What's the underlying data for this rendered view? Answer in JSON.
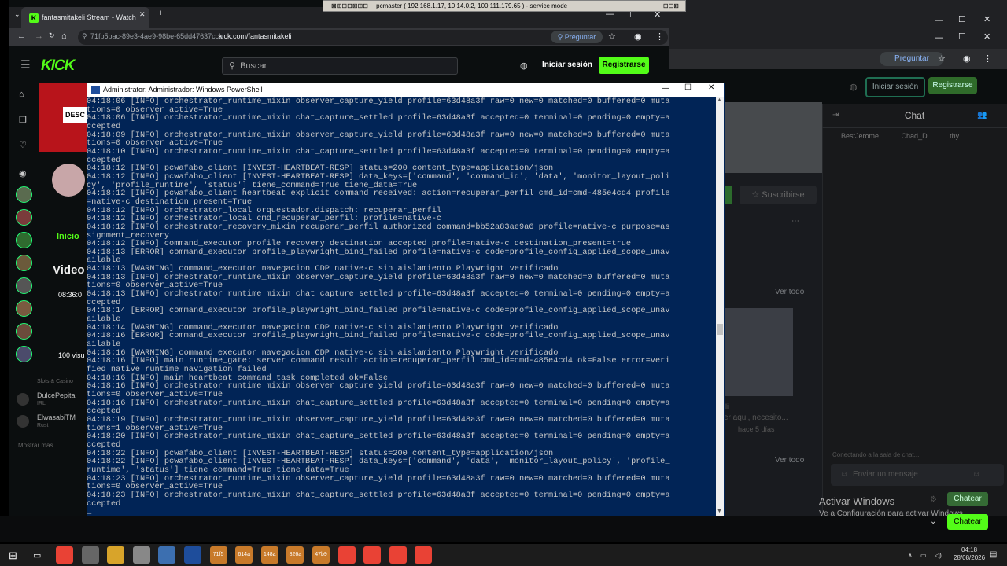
{
  "remote_bar": {
    "text": "pcmaster ( 192.168.1.17, 10.14.0.2, 100.111.179.65 ) - service mode"
  },
  "browser": {
    "tab_title": "fantasmitakeli Stream - Watch",
    "tab_close": "✕",
    "new_tab": "+",
    "omnibox_id": "71fb5bac-89e3-4ae9-98be-65dd47637cca",
    "url": "kick.com/fantasmitakeli",
    "ask_pill": "Preguntar"
  },
  "kick": {
    "logo": "KICK",
    "search_placeholder": "Buscar",
    "login": "Iniciar sesión",
    "register": "Registrarse",
    "banner_label": "DESC",
    "home_tab": "Inicio",
    "videos_heading": "Video",
    "video_duration": "08:36:0",
    "video_views": "100 visu",
    "side": [
      {
        "name": "Slots & Casino",
        "game": ""
      },
      {
        "name": "DulcePepita",
        "game": "IRL"
      },
      {
        "name": "ElwasabiTM",
        "game": "Rust"
      }
    ],
    "show_more": "Mostrar más"
  },
  "background_browser": {
    "ask_pill": "Preguntar",
    "login": "Iniciar sesión",
    "register": "Registrarse",
    "chat_title": "Chat",
    "chat_users": [
      "BestJerome",
      "Chad_D",
      "thy"
    ],
    "subscribe": "Suscribirse",
    "see_all_1": "Ver todo",
    "see_all_2": "Ver todo",
    "video_text": "er aqui, necesito...",
    "video_meta": "hace 5 días",
    "video_tag": "li",
    "connecting": "Conectando a la sala de chat...",
    "chat_placeholder": "Enviar un mensaje",
    "chat_button": "Chatear",
    "chat_button_2": "Chatear"
  },
  "activation": {
    "title": "Activar Windows",
    "subtitle": "Ve a Configuración para activar Windows."
  },
  "powershell": {
    "title": "Administrator: Administrador: Windows PowerShell",
    "lines": [
      "04:18:06 [INFO] orchestrator_runtime_mixin observer_capture_yield profile=63d48a3f raw=0 new=0 matched=0 buffered=0 muta",
      "tions=0 observer_active=True",
      "04:18:06 [INFO] orchestrator_runtime_mixin chat_capture_settled profile=63d48a3f accepted=0 terminal=0 pending=0 empty=a",
      "ccepted",
      "04:18:09 [INFO] orchestrator_runtime_mixin observer_capture_yield profile=63d48a3f raw=0 new=0 matched=0 buffered=0 muta",
      "tions=0 observer_active=True",
      "04:18:10 [INFO] orchestrator_runtime_mixin chat_capture_settled profile=63d48a3f accepted=0 terminal=0 pending=0 empty=a",
      "ccepted",
      "04:18:12 [INFO] pcwafabo_client [INVEST-HEARTBEAT-RESP] status=200 content_type=application/json",
      "04:18:12 [INFO] pcwafabo_client [INVEST-HEARTBEAT-RESP] data_keys=['command', 'command_id', 'data', 'monitor_layout_poli",
      "cy', 'profile_runtime', 'status'] tiene_command=True tiene_data=True",
      "04:18:12 [INFO] pcwafabo_client heartbeat explicit command received: action=recuperar_perfil cmd_id=cmd-485e4cd4 profile",
      "=native-c destination_present=True",
      "04:18:12 [INFO] orchestrator_local orquestador.dispatch: recuperar_perfil",
      "04:18:12 [INFO] orchestrator_local cmd_recuperar_perfil: profile=native-c",
      "04:18:12 [INFO] orchestrator_recovery_mixin recuperar_perfil authorized command=bb52a83ae9a6 profile=native-c purpose=as",
      "signment_recovery",
      "04:18:12 [INFO] command_executor profile recovery destination accepted profile=native-c destination_present=true",
      "04:18:13 [ERROR] command_executor profile_playwright_bind_failed profile=native-c code=profile_config_applied_scope_unav",
      "ailable",
      "04:18:13 [WARNING] command_executor navegacion CDP native-c sin aislamiento Playwright verificado",
      "04:18:13 [INFO] orchestrator_runtime_mixin observer_capture_yield profile=63d48a3f raw=0 new=0 matched=0 buffered=0 muta",
      "tions=0 observer_active=True",
      "04:18:13 [INFO] orchestrator_runtime_mixin chat_capture_settled profile=63d48a3f accepted=0 terminal=0 pending=0 empty=a",
      "ccepted",
      "04:18:14 [ERROR] command_executor profile_playwright_bind_failed profile=native-c code=profile_config_applied_scope_unav",
      "ailable",
      "04:18:14 [WARNING] command_executor navegacion CDP native-c sin aislamiento Playwright verificado",
      "04:18:16 [ERROR] command_executor profile_playwright_bind_failed profile=native-c code=profile_config_applied_scope_unav",
      "ailable",
      "04:18:16 [WARNING] command_executor navegacion CDP native-c sin aislamiento Playwright verificado",
      "04:18:16 [INFO] main runtime_gate: server command result action=recuperar_perfil cmd_id=cmd-485e4cd4 ok=False error=veri",
      "fied native runtime navigation failed",
      "04:18:16 [INFO] main heartbeat command task completed ok=False",
      "04:18:16 [INFO] orchestrator_runtime_mixin observer_capture_yield profile=63d48a3f raw=0 new=0 matched=0 buffered=0 muta",
      "tions=0 observer_active=True",
      "04:18:16 [INFO] orchestrator_runtime_mixin chat_capture_settled profile=63d48a3f accepted=0 terminal=0 pending=0 empty=a",
      "ccepted",
      "04:18:19 [INFO] orchestrator_runtime_mixin observer_capture_yield profile=63d48a3f raw=0 new=0 matched=0 buffered=0 muta",
      "tions=1 observer_active=True",
      "04:18:20 [INFO] orchestrator_runtime_mixin chat_capture_settled profile=63d48a3f accepted=0 terminal=0 pending=0 empty=a",
      "ccepted",
      "04:18:22 [INFO] pcwafabo_client [INVEST-HEARTBEAT-RESP] status=200 content_type=application/json",
      "04:18:22 [INFO] pcwafabo_client [INVEST-HEARTBEAT-RESP] data_keys=['command', 'data', 'monitor_layout_policy', 'profile_",
      "runtime', 'status'] tiene_command=True tiene_data=True",
      "04:18:23 [INFO] orchestrator_runtime_mixin observer_capture_yield profile=63d48a3f raw=0 new=0 matched=0 buffered=0 muta",
      "tions=0 observer_active=True",
      "04:18:23 [INFO] orchestrator_runtime_mixin chat_capture_settled profile=63d48a3f accepted=0 terminal=0 pending=0 empty=a",
      "ccepted",
      "_"
    ]
  },
  "taskbar": {
    "apps": [
      "",
      "",
      "",
      "",
      "",
      "",
      "71f5",
      "614a",
      "148a",
      "826a",
      "47b9",
      "",
      "",
      "",
      ""
    ],
    "time": "04:18",
    "date": "28/08/2026"
  }
}
